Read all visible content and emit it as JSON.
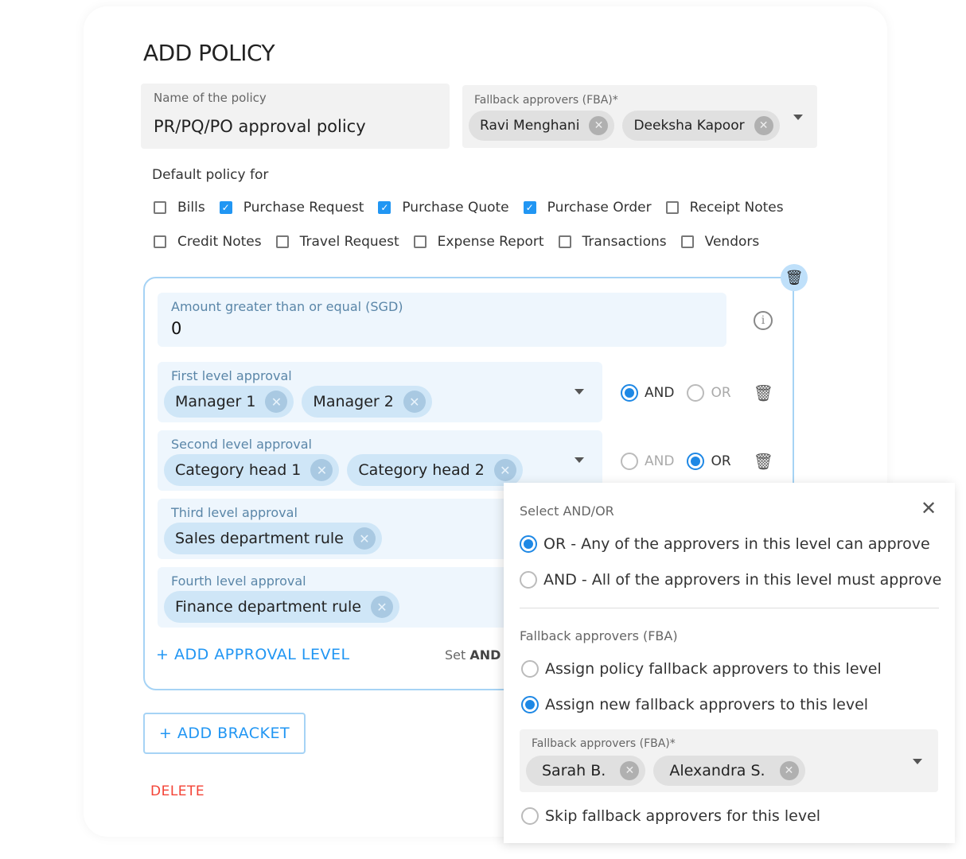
{
  "title": "ADD POLICY",
  "policy_name": {
    "label": "Name of the policy",
    "value": "PR/PQ/PO approval policy"
  },
  "fba": {
    "label": "Fallback approvers (FBA)*",
    "chips": [
      "Ravi Menghani",
      "Deeksha Kapoor"
    ]
  },
  "default_policy": {
    "label": "Default policy for",
    "row1": [
      {
        "label": "Bills",
        "checked": false
      },
      {
        "label": "Purchase Request",
        "checked": true
      },
      {
        "label": "Purchase Quote",
        "checked": true
      },
      {
        "label": "Purchase Order",
        "checked": true
      },
      {
        "label": "Receipt Notes",
        "checked": false
      }
    ],
    "row2": [
      {
        "label": "Credit Notes",
        "checked": false
      },
      {
        "label": "Travel Request",
        "checked": false
      },
      {
        "label": "Expense Report",
        "checked": false
      },
      {
        "label": "Transactions",
        "checked": false
      },
      {
        "label": "Vendors",
        "checked": false
      }
    ]
  },
  "bracket": {
    "amount_label": "Amount greater than or equal (SGD)",
    "amount_value": "0",
    "levels": [
      {
        "label": "First level approval",
        "chips": [
          "Manager 1",
          "Manager 2"
        ],
        "mode": "AND"
      },
      {
        "label": "Second level approval",
        "chips": [
          "Category head 1",
          "Category head 2"
        ],
        "mode": "OR"
      },
      {
        "label": "Third level approval",
        "chips": [
          "Sales department rule"
        ]
      },
      {
        "label": "Fourth level approval",
        "chips": [
          "Finance department rule"
        ]
      }
    ],
    "and_label": "AND",
    "or_label": "OR",
    "add_level": "+ ADD APPROVAL LEVEL",
    "set_prefix": "Set",
    "set_bold": "AND"
  },
  "add_bracket": "+ ADD BRACKET",
  "delete": "DELETE",
  "popup": {
    "title": "Select AND/OR",
    "options": [
      "OR - Any of the approvers in this level can approve",
      "AND - All of the approvers in this level must approve"
    ],
    "selected": 0,
    "fba_title": "Fallback approvers (FBA)",
    "fba_options": [
      "Assign policy fallback approvers to this level",
      "Assign new fallback approvers to this level",
      "Skip fallback approvers for this level"
    ],
    "fba_selected": 1,
    "fba_field_label": "Fallback approvers (FBA)*",
    "fba_chips": [
      "Sarah B.",
      "Alexandra S."
    ]
  },
  "colors": {
    "accent": "#2196f3",
    "danger": "#f44336",
    "bracket_border": "#a6d3f5"
  }
}
